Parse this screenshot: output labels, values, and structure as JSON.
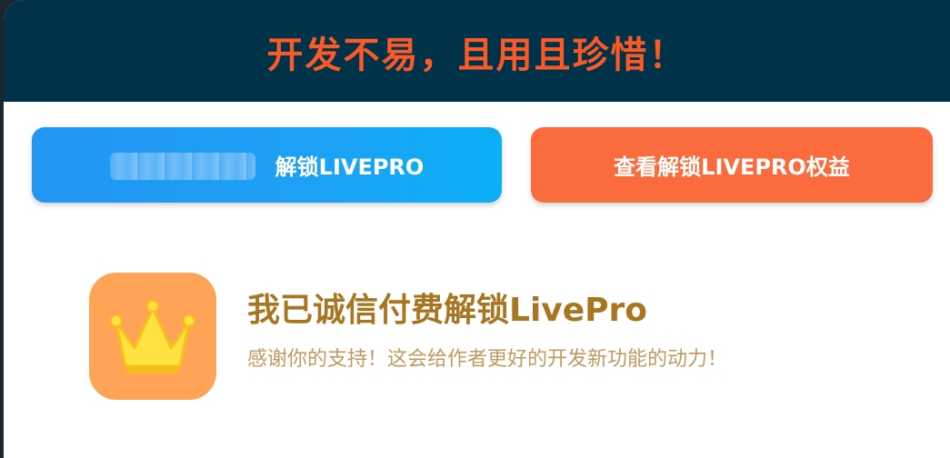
{
  "header": {
    "title": "开发不易，且用且珍惜！"
  },
  "buttons": {
    "unlock_label": "解锁LIVEPRO",
    "view_benefits_label": "查看解锁LIVEPRO权益"
  },
  "pro_option": {
    "title": "我已诚信付费解锁LivePro",
    "subtitle": "感谢你的支持！这会给作者更好的开发新功能的动力！",
    "icon": "crown-icon"
  },
  "colors": {
    "header_bg": "#003349",
    "header_text": "#fb5a27",
    "blue_button": "#1da1f5",
    "orange_button": "#fa6c3d",
    "crown_tile": "#ffa456",
    "pro_title": "#a87520",
    "pro_subtitle": "#c19a60"
  }
}
